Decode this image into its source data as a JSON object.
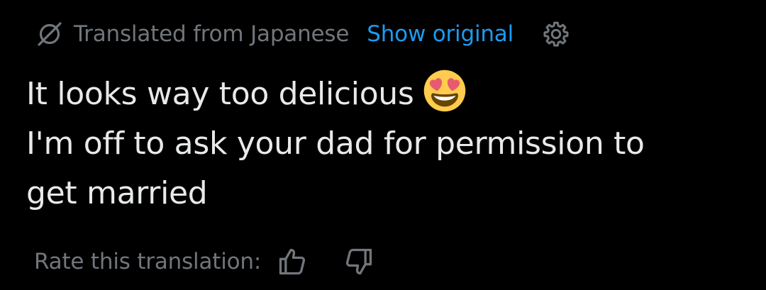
{
  "translation_header": {
    "icon": "translate-icon",
    "label": "Translated from Japanese",
    "show_original_label": "Show original",
    "settings_icon": "gear-icon"
  },
  "tweet": {
    "lines": [
      "It looks way too delicious",
      "I'm off to ask your dad for permission to",
      "get married"
    ],
    "emoji": "smiling-face-with-heart-eyes-emoji"
  },
  "rating": {
    "label": "Rate this translation:",
    "thumbs_up_icon": "thumbs-up-icon",
    "thumbs_down_icon": "thumbs-down-icon"
  },
  "colors": {
    "background": "#000000",
    "text_primary": "#e7e9ea",
    "text_secondary": "#71767b",
    "link": "#1d9bf0"
  }
}
